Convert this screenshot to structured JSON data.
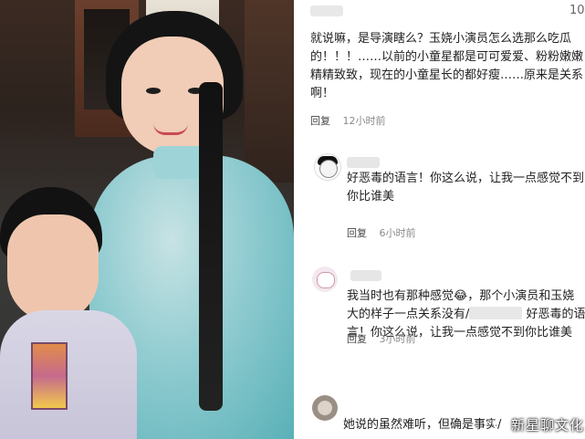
{
  "header": {
    "count_fragment": "10"
  },
  "comments": [
    {
      "lines": [
        "就说嘛，是导演瞎么？玉娆小演员怎么选那么吃瓜",
        "的！！！……以前的小童星都是可可爱爱、粉粉嫩嫩",
        "精精致致，现在的小童星长的都好瘦……原来是关系",
        "啊！"
      ],
      "reply": "回复",
      "time": "12小时前"
    },
    {
      "lines": [
        "好恶毒的语言！你这么说，让我一点感觉不到",
        "你比谁美"
      ],
      "reply": "回复",
      "time": "6小时前"
    },
    {
      "line1_prefix": "我当时也有那种感觉",
      "line1_emoji": "😂",
      "line1_suffix": "，那个小演员和玉娆",
      "line2_prefix": "大的样子一点关系没有/",
      "line2_suffix": " 好恶毒的语",
      "line3": "言！你这么说，让我一点感觉不到你比谁美",
      "reply": "回复",
      "time": "3小时前"
    },
    {
      "lines": [
        "她说的虽然难听，但确是事实/"
      ]
    }
  ],
  "watermark": {
    "text": "新星聊文化"
  }
}
